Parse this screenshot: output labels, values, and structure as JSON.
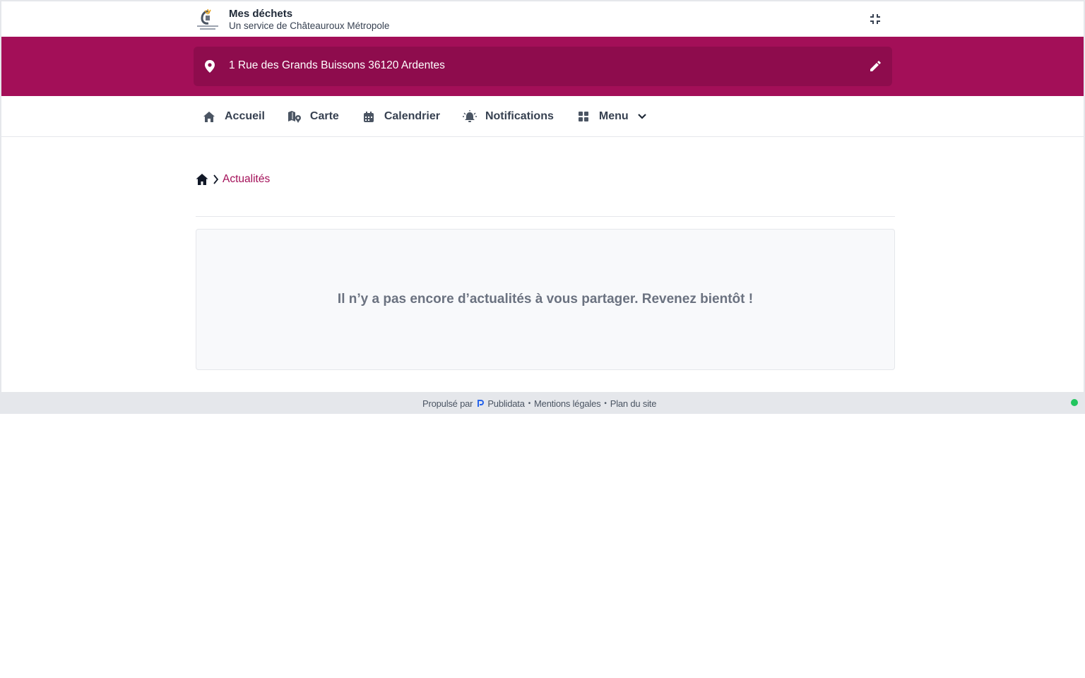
{
  "header": {
    "title": "Mes déchets",
    "subtitle": "Un service de Châteauroux Métropole",
    "logo_text": "CHÂTEAUROUX MÉTROPOLE"
  },
  "address": {
    "value": "1 Rue des Grands Buissons 36120 Ardentes"
  },
  "nav": {
    "items": [
      {
        "label": "Accueil",
        "icon": "home-icon"
      },
      {
        "label": "Carte",
        "icon": "map-icon"
      },
      {
        "label": "Calendrier",
        "icon": "calendar-icon"
      },
      {
        "label": "Notifications",
        "icon": "bell-icon"
      },
      {
        "label": "Menu",
        "icon": "grid-icon"
      }
    ]
  },
  "breadcrumb": {
    "current": "Actualités"
  },
  "main": {
    "empty_message": "Il n’y a pas encore d’actualités à vous partager. Revenez bientôt !"
  },
  "footer": {
    "powered_by": "Propulsé par",
    "brand": "Publidata",
    "legal": "Mentions légales",
    "sitemap": "Plan du site",
    "separator": "•"
  },
  "colors": {
    "brand": "#a30f58",
    "brand_dark": "#8e0c4d",
    "status": "#22c55e"
  }
}
